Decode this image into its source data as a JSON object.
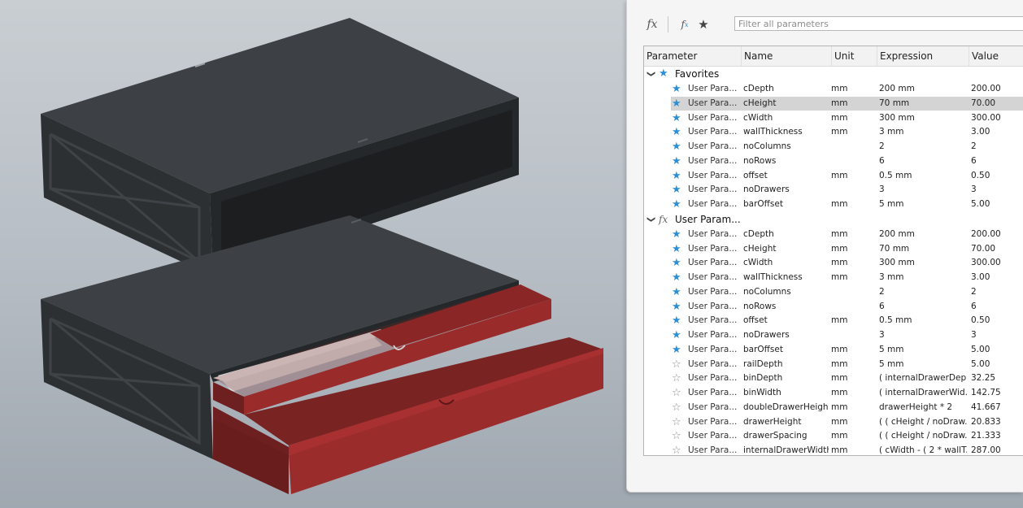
{
  "toolbar": {
    "fx_icon": "fx-icon",
    "fx_user_icon": "fx-user-icon",
    "favorite_icon": "star-icon",
    "filter_placeholder": "Filter all parameters"
  },
  "columns": {
    "parameter": "Parameter",
    "name": "Name",
    "unit": "Unit",
    "expression": "Expression",
    "value": "Value"
  },
  "colors": {
    "accent_star": "#2a8fd6",
    "body_dark": "#3b3e42",
    "drawer_red": "#8b2525"
  },
  "groups": {
    "favorites": {
      "label": "Favorites",
      "rows": [
        {
          "param": "User Para...",
          "name": "cDepth",
          "unit": "mm",
          "expr": "200 mm",
          "value": "200.00",
          "fav": true
        },
        {
          "param": "User Para...",
          "name": "cHeight",
          "unit": "mm",
          "expr": "70 mm",
          "value": "70.00",
          "fav": true,
          "selected": true
        },
        {
          "param": "User Para...",
          "name": "cWidth",
          "unit": "mm",
          "expr": "300 mm",
          "value": "300.00",
          "fav": true
        },
        {
          "param": "User Para...",
          "name": "wallThickness",
          "unit": "mm",
          "expr": "3 mm",
          "value": "3.00",
          "fav": true
        },
        {
          "param": "User Para...",
          "name": "noColumns",
          "unit": "",
          "expr": "2",
          "value": "2",
          "fav": true
        },
        {
          "param": "User Para...",
          "name": "noRows",
          "unit": "",
          "expr": "6",
          "value": "6",
          "fav": true
        },
        {
          "param": "User Para...",
          "name": "offset",
          "unit": "mm",
          "expr": "0.5 mm",
          "value": "0.50",
          "fav": true
        },
        {
          "param": "User Para...",
          "name": "noDrawers",
          "unit": "",
          "expr": "3",
          "value": "3",
          "fav": true
        },
        {
          "param": "User Para...",
          "name": "barOffset",
          "unit": "mm",
          "expr": "5 mm",
          "value": "5.00",
          "fav": true
        }
      ]
    },
    "user": {
      "label": "User Param...",
      "rows": [
        {
          "param": "User Para...",
          "name": "cDepth",
          "unit": "mm",
          "expr": "200 mm",
          "value": "200.00",
          "fav": true
        },
        {
          "param": "User Para...",
          "name": "cHeight",
          "unit": "mm",
          "expr": "70 mm",
          "value": "70.00",
          "fav": true
        },
        {
          "param": "User Para...",
          "name": "cWidth",
          "unit": "mm",
          "expr": "300 mm",
          "value": "300.00",
          "fav": true
        },
        {
          "param": "User Para...",
          "name": "wallThickness",
          "unit": "mm",
          "expr": "3 mm",
          "value": "3.00",
          "fav": true
        },
        {
          "param": "User Para...",
          "name": "noColumns",
          "unit": "",
          "expr": "2",
          "value": "2",
          "fav": true
        },
        {
          "param": "User Para...",
          "name": "noRows",
          "unit": "",
          "expr": "6",
          "value": "6",
          "fav": true
        },
        {
          "param": "User Para...",
          "name": "offset",
          "unit": "mm",
          "expr": "0.5 mm",
          "value": "0.50",
          "fav": true
        },
        {
          "param": "User Para...",
          "name": "noDrawers",
          "unit": "",
          "expr": "3",
          "value": "3",
          "fav": true
        },
        {
          "param": "User Para...",
          "name": "barOffset",
          "unit": "mm",
          "expr": "5 mm",
          "value": "5.00",
          "fav": true
        },
        {
          "param": "User Para...",
          "name": "railDepth",
          "unit": "mm",
          "expr": "5 mm",
          "value": "5.00",
          "fav": false
        },
        {
          "param": "User Para...",
          "name": "binDepth",
          "unit": "mm",
          "expr": "( internalDrawerDep...",
          "value": "32.25",
          "fav": false
        },
        {
          "param": "User Para...",
          "name": "binWidth",
          "unit": "mm",
          "expr": "( internalDrawerWid...",
          "value": "142.75",
          "fav": false
        },
        {
          "param": "User Para...",
          "name": "doubleDrawerHeight",
          "unit": "mm",
          "expr": "drawerHeight * 2",
          "value": "41.667",
          "fav": false
        },
        {
          "param": "User Para...",
          "name": "drawerHeight",
          "unit": "mm",
          "expr": "( ( cHeight / noDraw...",
          "value": "20.833",
          "fav": false
        },
        {
          "param": "User Para...",
          "name": "drawerSpacing",
          "unit": "mm",
          "expr": "( ( cHeight / noDraw...",
          "value": "21.333",
          "fav": false
        },
        {
          "param": "User Para...",
          "name": "internalDrawerWidth",
          "unit": "mm",
          "expr": "( cWidth - ( 2 * wallT...",
          "value": "287.00",
          "fav": false
        }
      ]
    }
  }
}
